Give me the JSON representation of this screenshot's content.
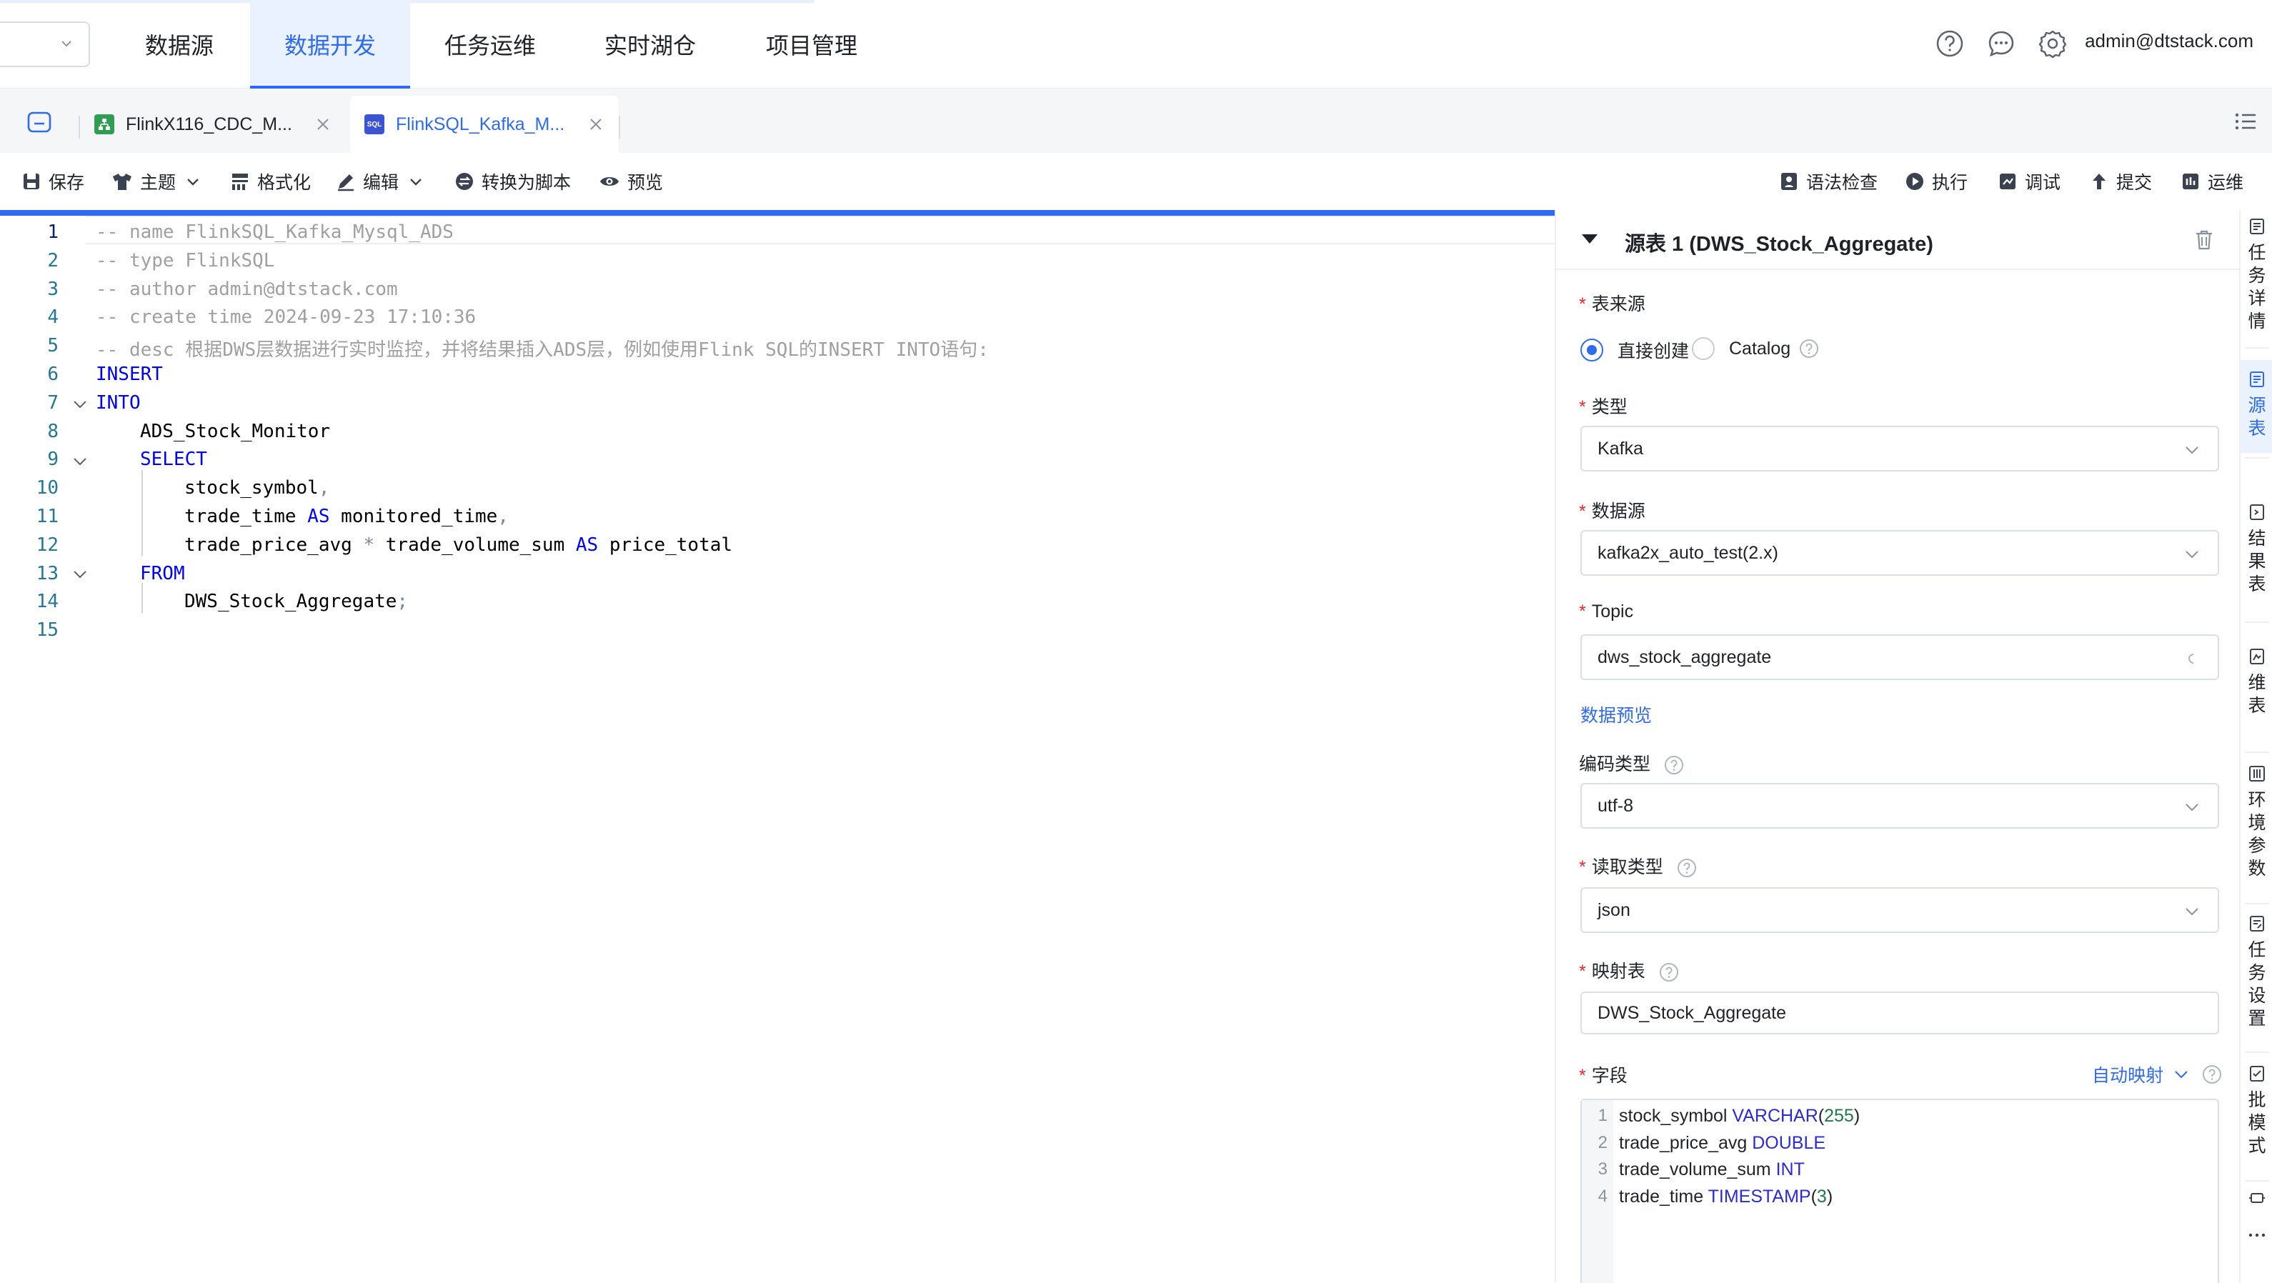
{
  "nav": {
    "items": [
      "数据源",
      "数据开发",
      "任务运维",
      "实时湖仓",
      "项目管理"
    ],
    "active": "数据开发",
    "user": "admin@dtstack.com"
  },
  "tabs": [
    {
      "label": "FlinkX116_CDC_M...",
      "icon": "flinkx-icon",
      "active": false
    },
    {
      "label": "FlinkSQL_Kafka_M...",
      "icon": "sql-icon",
      "active": true
    }
  ],
  "toolbar": {
    "save": "保存",
    "theme": "主题",
    "format": "格式化",
    "edit": "编辑",
    "convert": "转换为脚本",
    "preview": "预览",
    "syntax_check": "语法检查",
    "run": "执行",
    "debug": "调试",
    "submit": "提交",
    "ops": "运维"
  },
  "editor": {
    "lines": [
      "-- name FlinkSQL_Kafka_Mysql_ADS",
      "-- type FlinkSQL",
      "-- author admin@dtstack.com",
      "-- create time 2024-09-23 17:10:36",
      "-- desc 根据DWS层数据进行实时监控，并将结果插入ADS层，例如使用Flink SQL的INSERT INTO语句:",
      "INSERT",
      "INTO",
      "ADS_Stock_Monitor",
      "SELECT",
      "stock_symbol,",
      "trade_time AS monitored_time,",
      "trade_price_avg * trade_volume_sum AS price_total",
      "FROM",
      "DWS_Stock_Aggregate;",
      ""
    ],
    "line_numbers": [
      "1",
      "2",
      "3",
      "4",
      "5",
      "6",
      "7",
      "8",
      "9",
      "10",
      "11",
      "12",
      "13",
      "14",
      "15"
    ]
  },
  "panel": {
    "title": "源表 1 (DWS_Stock_Aggregate)",
    "source_label": "表来源",
    "source_options": [
      "直接创建",
      "Catalog"
    ],
    "source_selected": "直接创建",
    "type_label": "类型",
    "type_value": "Kafka",
    "datasource_label": "数据源",
    "datasource_value": "kafka2x_auto_test(2.x)",
    "topic_label": "Topic",
    "topic_value": "dws_stock_aggregate",
    "data_preview": "数据预览",
    "encoding_label": "编码类型",
    "encoding_value": "utf-8",
    "read_type_label": "读取类型",
    "read_type_value": "json",
    "mapping_label": "映射表",
    "mapping_value": "DWS_Stock_Aggregate",
    "fields_label": "字段",
    "auto_map": "自动映射",
    "fields": [
      {
        "num": "1",
        "name": "stock_symbol",
        "type": "VARCHAR",
        "arg": "(255)"
      },
      {
        "num": "2",
        "name": "trade_price_avg",
        "type": "DOUBLE",
        "arg": ""
      },
      {
        "num": "3",
        "name": "trade_volume_sum",
        "type": "INT",
        "arg": ""
      },
      {
        "num": "4",
        "name": "trade_time",
        "type": "TIMESTAMP",
        "arg": "(3)"
      }
    ]
  },
  "side": {
    "items": [
      "任务详情",
      "源表",
      "结果表",
      "维表",
      "环境参数",
      "任务设置",
      "批模式"
    ],
    "active": "源表"
  },
  "colors": {
    "accent": "#2e6bf0",
    "required": "#f5222d",
    "keyword": "#0000ff",
    "comment": "#a0a0a0"
  }
}
